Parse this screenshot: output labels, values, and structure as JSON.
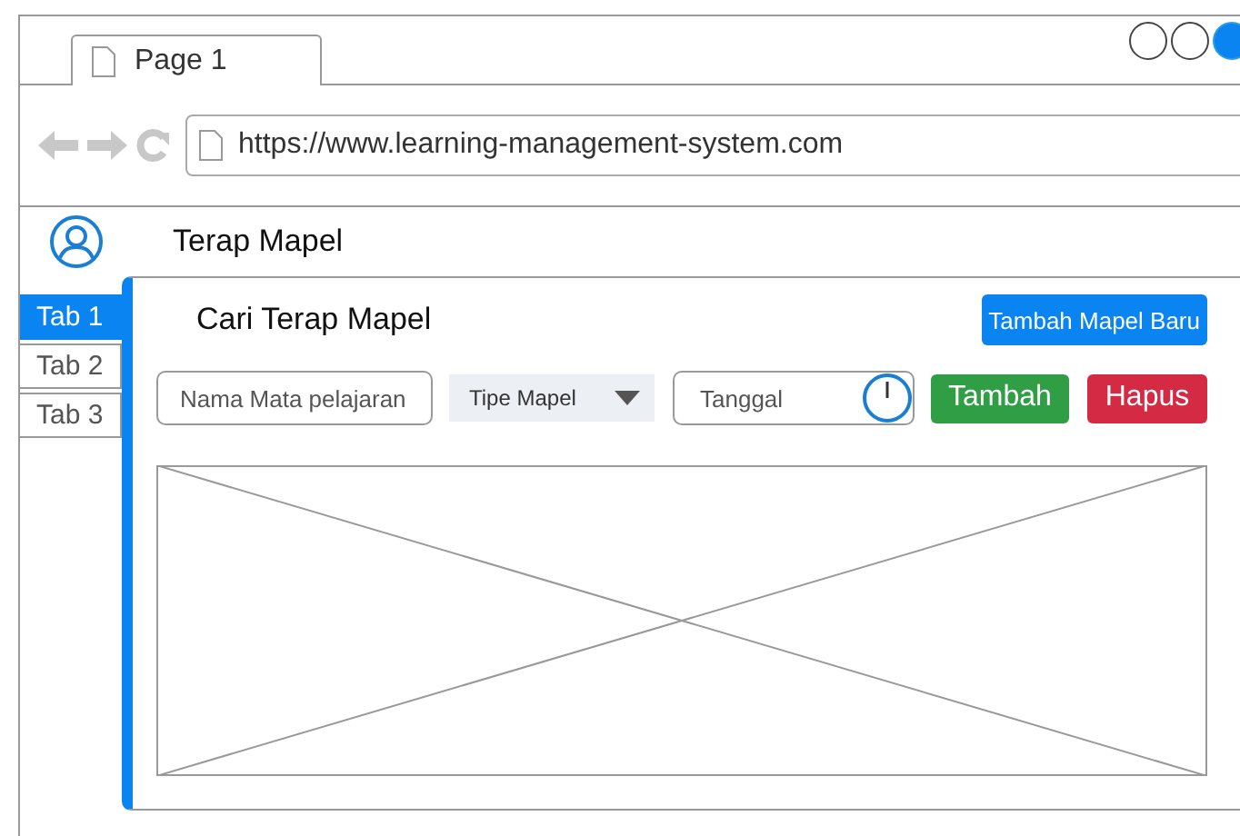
{
  "browser": {
    "tab_title": "Page 1",
    "url": "https://www.learning-management-system.com"
  },
  "page": {
    "title": "Terap Mapel"
  },
  "tabs": [
    {
      "label": "Tab 1",
      "selected": true
    },
    {
      "label": "Tab 2",
      "selected": false
    },
    {
      "label": "Tab 3",
      "selected": false
    }
  ],
  "panel": {
    "title": "Cari Terap Mapel",
    "add_new_button": "Tambah Mapel Baru",
    "filters": {
      "name_placeholder": "Nama Mata pelajaran",
      "type_select": "Tipe Mapel",
      "date_placeholder": "Tanggal"
    },
    "add_button": "Tambah",
    "delete_button": "Hapus"
  }
}
